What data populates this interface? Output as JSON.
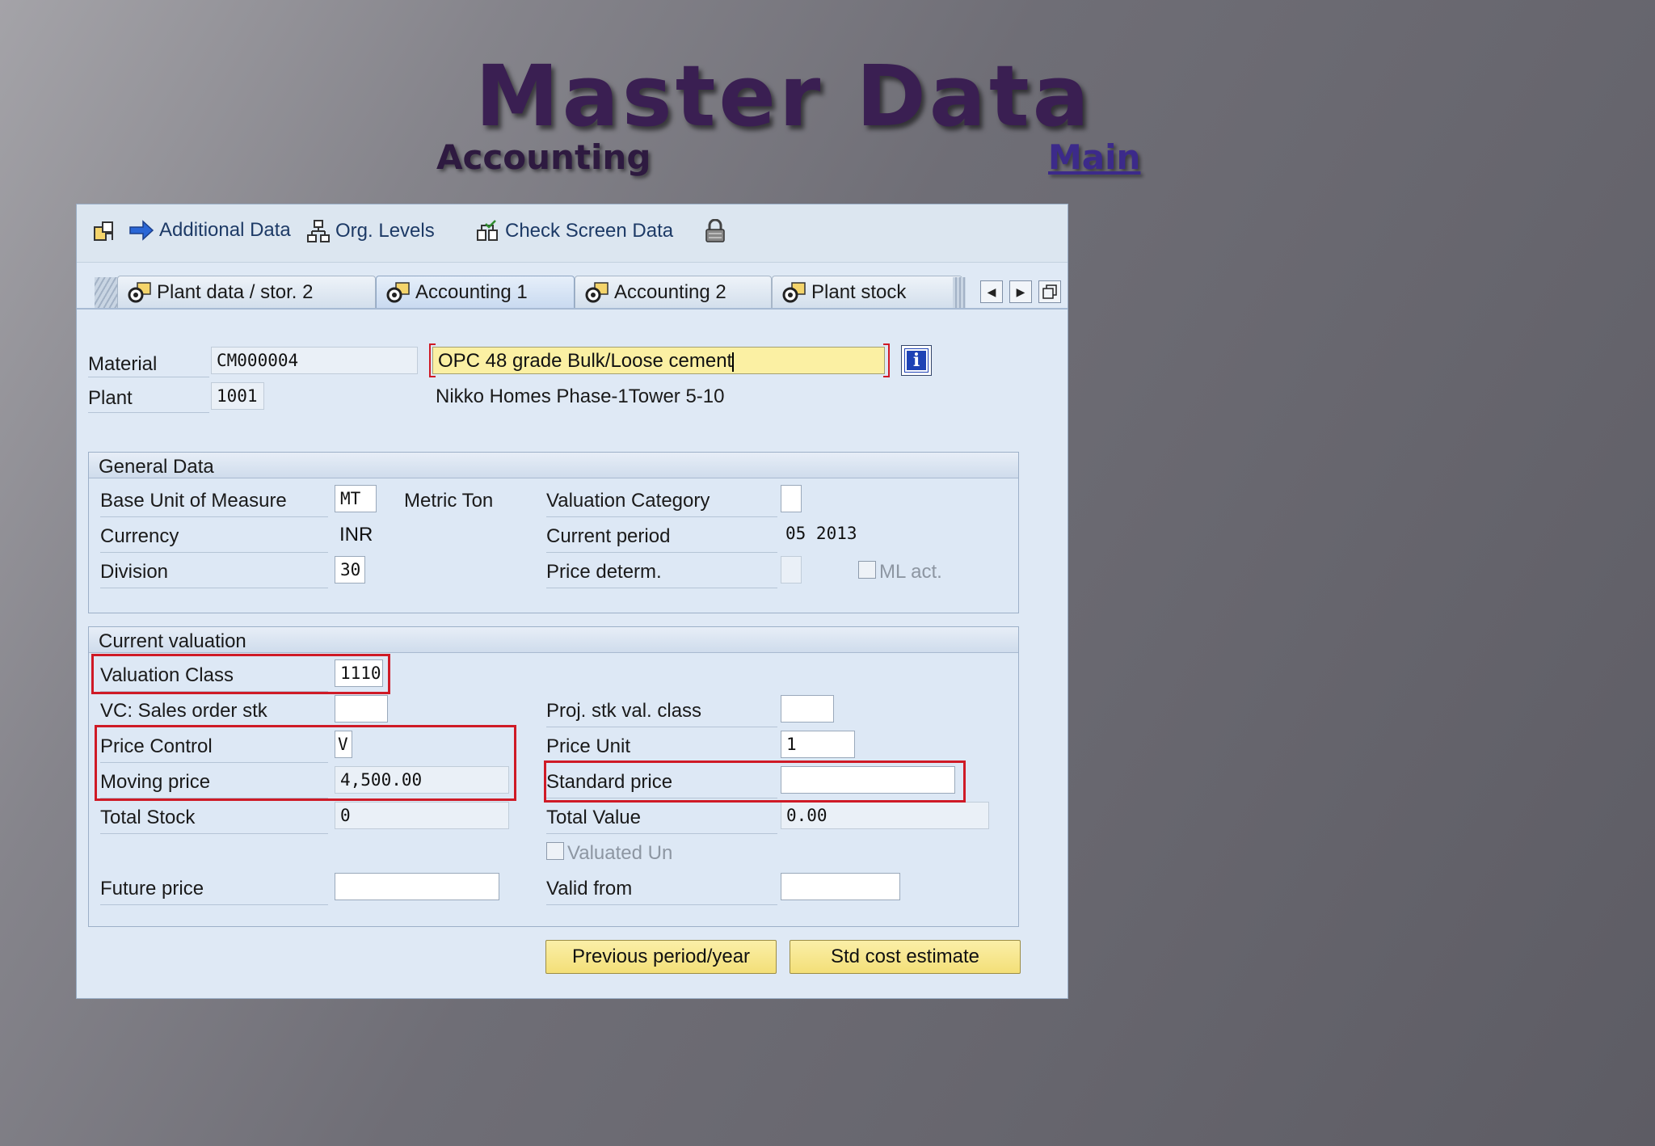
{
  "slide": {
    "title": "Master Data",
    "subtitle_left": "Accounting",
    "subtitle_right": "Main"
  },
  "toolbar": {
    "additional_data": "Additional Data",
    "org_levels": "Org. Levels",
    "check_screen_data": "Check Screen Data"
  },
  "tabs": [
    {
      "label": "Plant data / stor. 2",
      "active": false
    },
    {
      "label": "Accounting 1",
      "active": true
    },
    {
      "label": "Accounting 2",
      "active": false
    },
    {
      "label": "Plant stock",
      "active": false
    }
  ],
  "header": {
    "material_label": "Material",
    "material_value": "CM000004",
    "material_desc": "OPC 48 grade Bulk/Loose cement",
    "plant_label": "Plant",
    "plant_value": "1001",
    "plant_desc": "Nikko Homes Phase-1Tower 5-10"
  },
  "general_data": {
    "title": "General Data",
    "base_uom_label": "Base Unit of Measure",
    "base_uom_value": "MT",
    "base_uom_desc": "Metric Ton",
    "valuation_category_label": "Valuation Category",
    "valuation_category_value": "",
    "currency_label": "Currency",
    "currency_value": "INR",
    "current_period_label": "Current period",
    "current_period_value": "05 2013",
    "division_label": "Division",
    "division_value": "30",
    "price_determ_label": "Price determ.",
    "price_determ_value": "",
    "ml_act_label": "ML act."
  },
  "current_valuation": {
    "title": "Current valuation",
    "valuation_class_label": "Valuation Class",
    "valuation_class_value": "1110",
    "vc_sales_label": "VC: Sales order stk",
    "vc_sales_value": "",
    "proj_stk_label": "Proj. stk val. class",
    "proj_stk_value": "",
    "price_control_label": "Price Control",
    "price_control_value": "V",
    "price_unit_label": "Price Unit",
    "price_unit_value": "1",
    "moving_price_label": "Moving price",
    "moving_price_value": "4,500.00",
    "standard_price_label": "Standard price",
    "standard_price_value": "",
    "total_stock_label": "Total Stock",
    "total_stock_value": "0",
    "total_value_label": "Total Value",
    "total_value_value": "0.00",
    "valuated_un_label": "Valuated Un",
    "future_price_label": "Future price",
    "future_price_value": "",
    "valid_from_label": "Valid from",
    "valid_from_value": ""
  },
  "buttons": {
    "previous_period": "Previous period/year",
    "std_cost_estimate": "Std cost estimate"
  },
  "colors": {
    "highlight_red": "#cf1a26",
    "button_yellow": "#f3df78",
    "panel_blue": "#dfe9f5"
  }
}
